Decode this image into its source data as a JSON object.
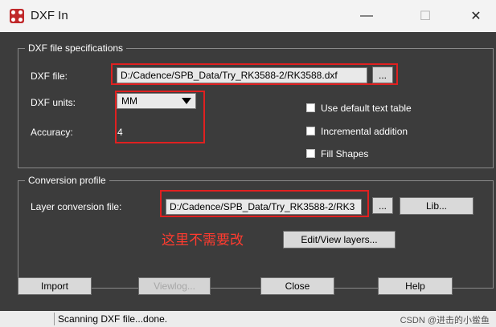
{
  "window": {
    "title": "DXF In",
    "minimize_glyph": "—",
    "maximize_glyph": "☐",
    "close_glyph": "✕"
  },
  "dxf_specs": {
    "legend": "DXF file specifications",
    "file_label": "DXF file:",
    "file_value": "D:/Cadence/SPB_Data/Try_RK3588-2/RK3588.dxf",
    "browse_label": "...",
    "units_label": "DXF units:",
    "units_value": "MM",
    "accuracy_label": "Accuracy:",
    "accuracy_value": "4",
    "options": [
      {
        "label": "Use default text table",
        "checked": false
      },
      {
        "label": "Incremental addition",
        "checked": false
      },
      {
        "label": "Fill Shapes",
        "checked": false
      }
    ]
  },
  "conversion": {
    "legend": "Conversion profile",
    "layer_label": "Layer conversion file:",
    "layer_value": "D:/Cadence/SPB_Data/Try_RK3588-2/RK3",
    "browse_label": "...",
    "lib_label": "Lib...",
    "edit_layers_label": "Edit/View layers...",
    "annotation": "这里不需要改"
  },
  "buttons": {
    "import": "Import",
    "viewlog": "Viewlog...",
    "close": "Close",
    "help": "Help"
  },
  "status": {
    "text": "Scanning DXF file...done.",
    "watermark": "CSDN @进击的小鲎鱼"
  },
  "colors": {
    "dialog_bg": "#3c3c3c",
    "highlight": "#e02020"
  }
}
